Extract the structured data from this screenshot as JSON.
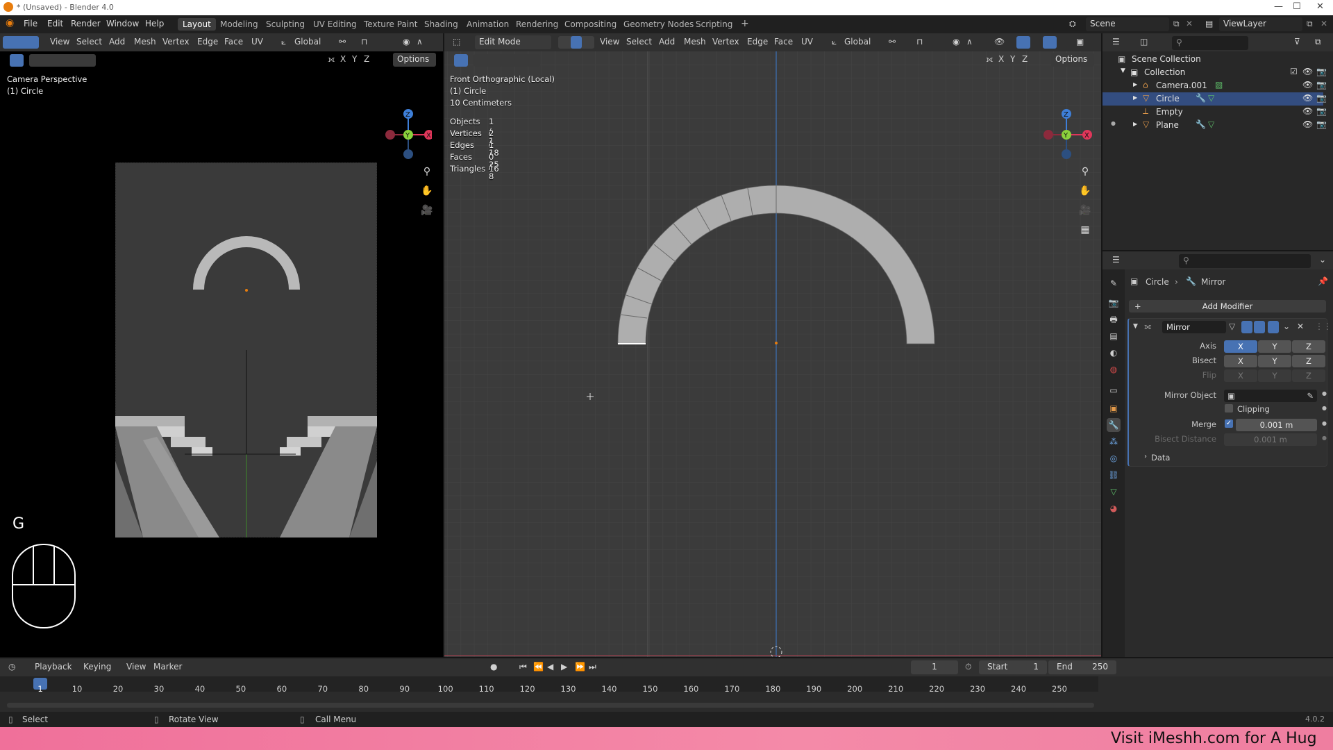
{
  "titlebar": {
    "title": "* (Unsaved) - Blender 4.0"
  },
  "menus": [
    "File",
    "Edit",
    "Render",
    "Window",
    "Help"
  ],
  "workspaces": [
    "Layout",
    "Modeling",
    "Sculpting",
    "UV Editing",
    "Texture Paint",
    "Shading",
    "Animation",
    "Rendering",
    "Compositing",
    "Geometry Nodes",
    "Scripting"
  ],
  "active_workspace": "Layout",
  "scene": "Scene",
  "view_layer": "ViewLayer",
  "left_viewport": {
    "header": [
      "View",
      "Select",
      "Add",
      "Mesh",
      "Vertex",
      "Edge",
      "Face",
      "UV"
    ],
    "transform": "Global",
    "options": "Options",
    "axes": [
      "X",
      "Y",
      "Z"
    ],
    "info_line1": "Camera Perspective",
    "info_line2": "(1) Circle",
    "key": "G"
  },
  "main_viewport": {
    "mode": "Edit Mode",
    "header": [
      "View",
      "Select",
      "Add",
      "Mesh",
      "Vertex",
      "Edge",
      "Face",
      "UV"
    ],
    "transform": "Global",
    "options": "Options",
    "axes": [
      "X",
      "Y",
      "Z"
    ],
    "info_line1": "Front Orthographic (Local)",
    "info_line2": "(1) Circle",
    "info_line3": "10 Centimeters",
    "stats": [
      {
        "label": "Objects",
        "value": "1 / 1"
      },
      {
        "label": "Vertices",
        "value": "2 / 18"
      },
      {
        "label": "Edges",
        "value": "1 / 25"
      },
      {
        "label": "Faces",
        "value": "0 / 8"
      },
      {
        "label": "Triangles",
        "value": "16"
      }
    ]
  },
  "outliner": {
    "root": "Scene Collection",
    "collection": "Collection",
    "items": [
      {
        "name": "Camera.001",
        "icon": "camera-icon",
        "selected": false
      },
      {
        "name": "Circle",
        "icon": "mesh-icon",
        "selected": true
      },
      {
        "name": "Empty",
        "icon": "empty-icon",
        "selected": false
      },
      {
        "name": "Plane",
        "icon": "mesh-icon",
        "selected": false
      }
    ]
  },
  "properties": {
    "breadcrumb_object": "Circle",
    "breadcrumb_modifier": "Mirror",
    "add_modifier": "Add Modifier",
    "modifier_name": "Mirror",
    "axis_label": "Axis",
    "bisect_label": "Bisect",
    "flip_label": "Flip",
    "xyz": [
      "X",
      "Y",
      "Z"
    ],
    "mirror_object_label": "Mirror Object",
    "clipping_label": "Clipping",
    "merge_label": "Merge",
    "merge_value": "0.001 m",
    "bisect_distance_label": "Bisect Distance",
    "bisect_distance_value": "0.001 m",
    "data_label": "Data"
  },
  "timeline": {
    "menus": [
      "Playback",
      "Keying",
      "View",
      "Marker"
    ],
    "current_frame": "1",
    "start_label": "Start",
    "start": "1",
    "end_label": "End",
    "end": "250",
    "ticks": [
      "1",
      "10",
      "20",
      "30",
      "40",
      "50",
      "60",
      "70",
      "80",
      "90",
      "100",
      "110",
      "120",
      "130",
      "140",
      "150",
      "160",
      "170",
      "180",
      "190",
      "200",
      "210",
      "220",
      "230",
      "240",
      "250"
    ]
  },
  "status": {
    "select": "Select",
    "rotate": "Rotate View",
    "call_menu": "Call Menu",
    "version": "4.0.2"
  },
  "promo": "Visit iMeshh.com for A Hug",
  "colors": {
    "accent": "#4772b3",
    "orange": "#e87d0d",
    "x_axis": "#e0365a",
    "y_axis": "#8bd13c",
    "z_axis": "#3e7fd8"
  }
}
